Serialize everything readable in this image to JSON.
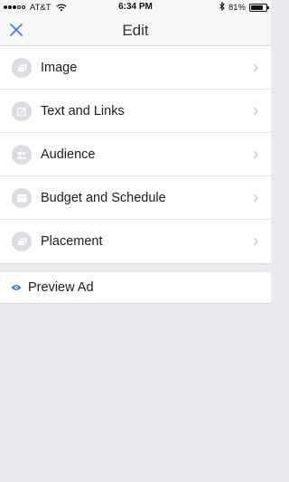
{
  "status": {
    "carrier": "AT&T",
    "time": "6:34 PM",
    "battery": "81%",
    "battery_level": 0.81
  },
  "nav": {
    "title": "Edit",
    "close_icon": "close-icon"
  },
  "menu": {
    "items": [
      {
        "label": "Image",
        "icon": "image-icon"
      },
      {
        "label": "Text and Links",
        "icon": "edit-icon"
      },
      {
        "label": "Audience",
        "icon": "people-icon"
      },
      {
        "label": "Budget and Schedule",
        "icon": "calendar-icon"
      },
      {
        "label": "Placement",
        "icon": "placement-icon"
      }
    ]
  },
  "preview": {
    "label": "Preview Ad",
    "icon": "eye-icon"
  },
  "colors": {
    "accent": "#3b7be0",
    "icon_bg": "#dcdde2",
    "icon_fg": "#ffffff",
    "background": "#e9e9ee"
  }
}
